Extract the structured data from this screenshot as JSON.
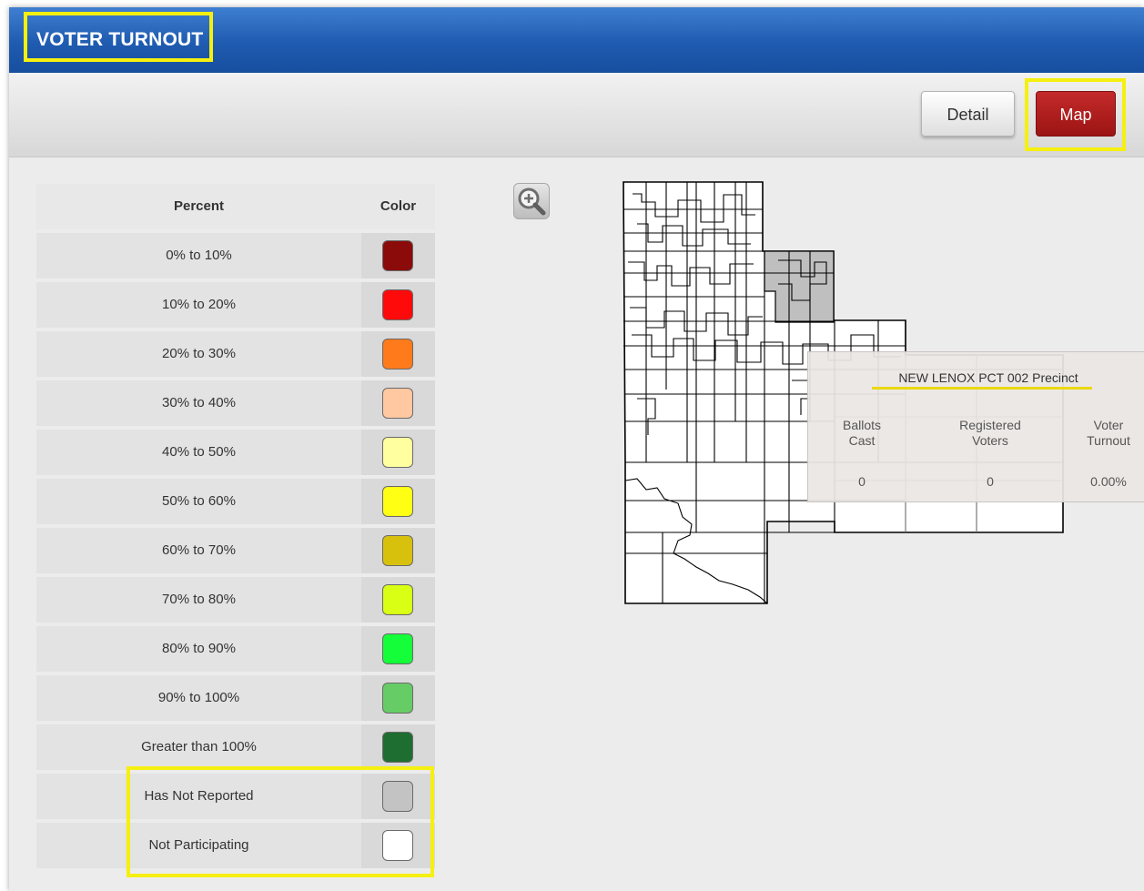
{
  "header": {
    "title": "VOTER TURNOUT"
  },
  "toolbar": {
    "detail_label": "Detail",
    "map_label": "Map"
  },
  "legend": {
    "header_percent": "Percent",
    "header_color": "Color",
    "rows": [
      {
        "label": "0% to 10%",
        "color": "#8b0a0a"
      },
      {
        "label": "10% to 20%",
        "color": "#ff0a0a"
      },
      {
        "label": "20% to 30%",
        "color": "#ff7a1a"
      },
      {
        "label": "30% to 40%",
        "color": "#ffc8a0"
      },
      {
        "label": "40% to 50%",
        "color": "#ffffa0"
      },
      {
        "label": "50% to 60%",
        "color": "#ffff14"
      },
      {
        "label": "60% to 70%",
        "color": "#d8c10c"
      },
      {
        "label": "70% to 80%",
        "color": "#d8ff14"
      },
      {
        "label": "80% to 90%",
        "color": "#14ff3a"
      },
      {
        "label": "90% to 100%",
        "color": "#66cc66"
      },
      {
        "label": "Greater than 100%",
        "color": "#1e6e32"
      },
      {
        "label": "Has Not Reported",
        "color": "#c3c3c3"
      },
      {
        "label": "Not Participating",
        "color": "#ffffff"
      }
    ]
  },
  "popup": {
    "precinct": "NEW LENOX PCT 002 Precinct",
    "col1_line1": "Ballots",
    "col1_line2": "Cast",
    "col2_line1": "Registered",
    "col2_line2": "Voters",
    "col3_line1": "Voter",
    "col3_line2": "Turnout",
    "ballots_cast": "0",
    "registered_voters": "0",
    "voter_turnout": "0.00%"
  },
  "icons": {
    "zoom": "zoom-in-icon"
  },
  "colors": {
    "highlight": "#f5f00f",
    "header_blue": "#1f5bb0",
    "active_button": "#b01c1c",
    "reported_gray": "#c3c3c3"
  }
}
